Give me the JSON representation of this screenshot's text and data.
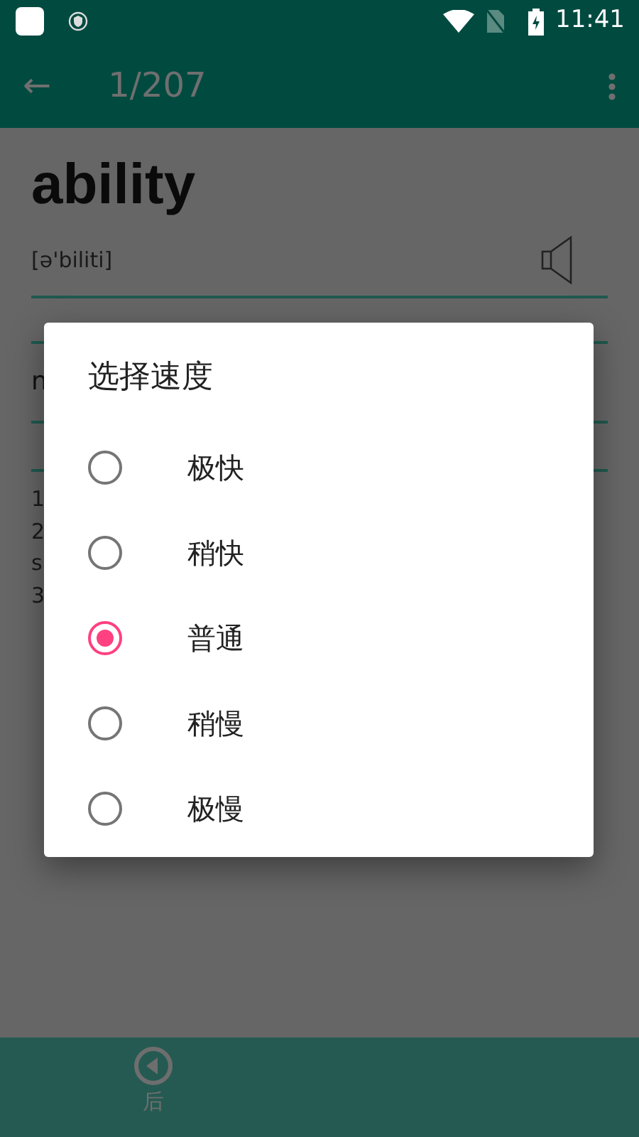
{
  "status_bar": {
    "time": "11:41"
  },
  "app_bar": {
    "back": "←",
    "title": "1/207"
  },
  "word": {
    "headword": "ability",
    "phonetic": "[ə'biliti]",
    "part_of_speech": "n",
    "lines": [
      "1",
      "2",
      "s",
      "3"
    ]
  },
  "dialog": {
    "title": "选择速度",
    "options": [
      {
        "label": "极快",
        "selected": false
      },
      {
        "label": "稍快",
        "selected": false
      },
      {
        "label": "普通",
        "selected": true
      },
      {
        "label": "稍慢",
        "selected": false
      },
      {
        "label": "极慢",
        "selected": false
      }
    ]
  },
  "bottom_bar": {
    "items": [
      {
        "label": "后"
      }
    ]
  }
}
